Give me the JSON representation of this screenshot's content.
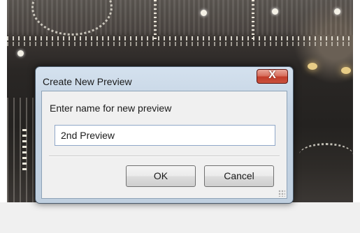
{
  "dialog": {
    "title": "Create New Preview",
    "close_label": "X",
    "prompt": "Enter name for new preview",
    "input_value": "2nd Preview",
    "ok_label": "OK",
    "cancel_label": "Cancel"
  },
  "colors": {
    "titlebar": "#c5d4e4",
    "close_button": "#c23c2a",
    "client": "#f0f0f0"
  }
}
